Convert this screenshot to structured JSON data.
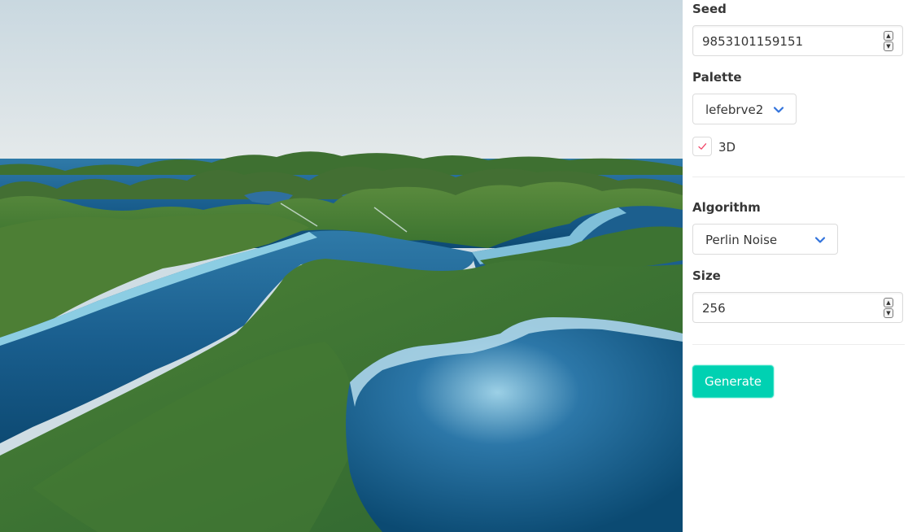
{
  "controls": {
    "seed": {
      "label": "Seed",
      "value": "9853101159151"
    },
    "palette": {
      "label": "Palette",
      "selected": "lefebrve2"
    },
    "three_d": {
      "label": "3D",
      "checked": true
    },
    "algorithm": {
      "label": "Algorithm",
      "selected": "Perlin Noise"
    },
    "size": {
      "label": "Size",
      "value": "256"
    },
    "generate_label": "Generate"
  },
  "icons": {
    "spinner_up": "spinner-up-icon",
    "spinner_down": "spinner-down-icon",
    "chevron_down": "chevron-down-icon",
    "checkmark": "checkmark-icon"
  },
  "colors": {
    "accent": "#00d1b2",
    "select_arrow": "#3273dc",
    "checkmark": "#f14668",
    "terrain_green": "#3f7a33",
    "water_blue": "#1e5f8c",
    "sky": "#dfe6ea"
  }
}
